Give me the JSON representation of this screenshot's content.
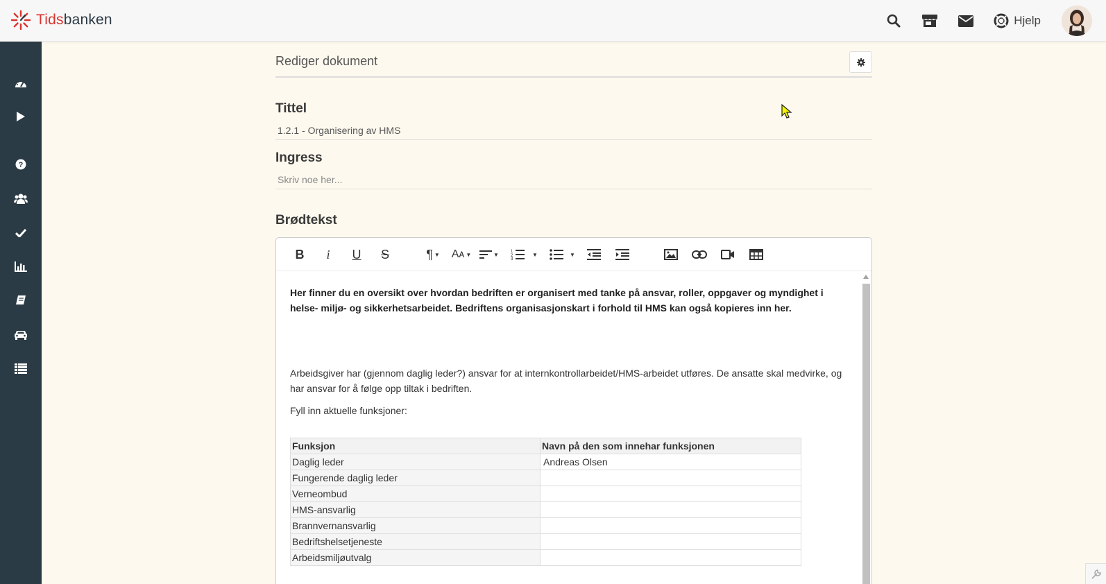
{
  "app": {
    "logo_prefix": "Tids",
    "logo_suffix": "banken",
    "brand_color": "#d9332f"
  },
  "topbar": {
    "icons": [
      "search-icon",
      "store-icon",
      "mail-icon"
    ],
    "help_label": "Hjelp"
  },
  "sidebar": {
    "items": [
      "dashboard-icon",
      "play-icon",
      "question-icon",
      "users-icon",
      "check-icon",
      "chart-icon",
      "book-icon",
      "car-icon",
      "list-icon"
    ]
  },
  "page": {
    "title": "Rediger dokument"
  },
  "form": {
    "title_label": "Tittel",
    "title_value": "1.2.1 - Organisering av HMS",
    "ingress_label": "Ingress",
    "ingress_placeholder": "Skriv noe her...",
    "body_label": "Brødtekst"
  },
  "editor": {
    "intro_line1": "Her finner du en oversikt over hvordan bedriften er organisert med tanke på ansvar, roller, oppgaver og myndighet i",
    "intro_line2": "helse- miljø- og sikkerhetsarbeidet. Bedriftens organisasjonskart i forhold til HMS kan også kopieres inn her.",
    "para1_line1": "Arbeidsgiver har (gjennom daglig leder?) ansvar for at internkontrollarbeidet/HMS-arbeidet utføres. De ansatte skal medvirke, og",
    "para1_line2": "har ansvar for å følge opp tiltak i bedriften.",
    "para2": "Fyll inn aktuelle funksjoner:",
    "table": {
      "headers": [
        "Funksjon",
        "Navn på den som innehar funksjonen"
      ],
      "rows": [
        [
          "Daglig leder",
          "Andreas Olsen"
        ],
        [
          "Fungerende daglig leder",
          ""
        ],
        [
          "Verneombud",
          ""
        ],
        [
          "HMS-ansvarlig",
          ""
        ],
        [
          "Brannvernansvarlig",
          ""
        ],
        [
          "Bedriftshelsetjeneste",
          ""
        ],
        [
          "Arbeidsmiljøutvalg",
          ""
        ]
      ]
    }
  }
}
